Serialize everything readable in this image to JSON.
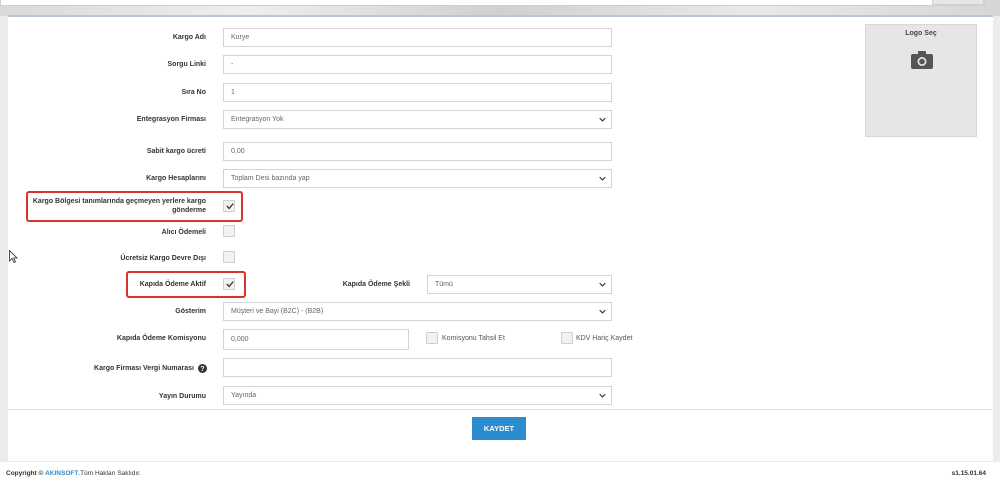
{
  "form": {
    "kargo_adi": {
      "label": "Kargo Adı",
      "value": "Kurye"
    },
    "sorgu_linki": {
      "label": "Sorgu Linki",
      "value": "-"
    },
    "sira_no": {
      "label": "Sıra No",
      "value": "1"
    },
    "entegrasyon": {
      "label": "Entegrasyon Firması",
      "value": "Entegrasyon Yok"
    },
    "sabit_ucret": {
      "label": "Sabit kargo ücreti",
      "value": "0,00"
    },
    "kargo_hesaplama": {
      "label": "Kargo Hesaplarını",
      "value": "Toplam Desi bazında yap"
    },
    "bolge_disi": {
      "label_line1": "Kargo Bölgesi tanımlarında geçmeyen yerlere kargo",
      "label_line2": "gönderme",
      "checked": true
    },
    "alici_odemeli": {
      "label": "Alıcı Ödemeli",
      "checked": false
    },
    "ucretsiz_devre_disi": {
      "label": "Ücretsiz Kargo Devre Dışı",
      "checked": false
    },
    "kapida_odeme_aktif": {
      "label": "Kapıda Ödeme Aktif",
      "checked": true
    },
    "kapida_odeme_sekli": {
      "label": "Kapıda Ödeme Şekli",
      "value": "Tümü"
    },
    "gosterim": {
      "label": "Gösterim",
      "value": "Müşteri ve Bayi (B2C) - (B2B)"
    },
    "komisyon": {
      "label": "Kapıda Ödeme Komisyonu",
      "value": "0,000"
    },
    "komisyon_tahsil": {
      "label": "Komisyonu Tahsil Et",
      "checked": false
    },
    "kdv_haric": {
      "label": "KDV Hariç Kaydet",
      "checked": false
    },
    "vergi_no": {
      "label": "Kargo Firması Vergi Numarası",
      "value": ""
    },
    "yayin_durumu": {
      "label": "Yayın Durumu",
      "value": "Yayında"
    }
  },
  "logo": {
    "label": "Logo Seç",
    "icon": "camera-icon"
  },
  "actions": {
    "save_label": "KAYDET"
  },
  "footer": {
    "copyright_prefix": "Copyright ©",
    "brand": "AKINSOFT",
    "rights": ".Tüm Hakları Saklıdır.",
    "version": "s1.15.01.64"
  },
  "colors": {
    "accent": "#2b8ccf",
    "highlight": "#d9342b",
    "brand": "#2b8ccf"
  }
}
